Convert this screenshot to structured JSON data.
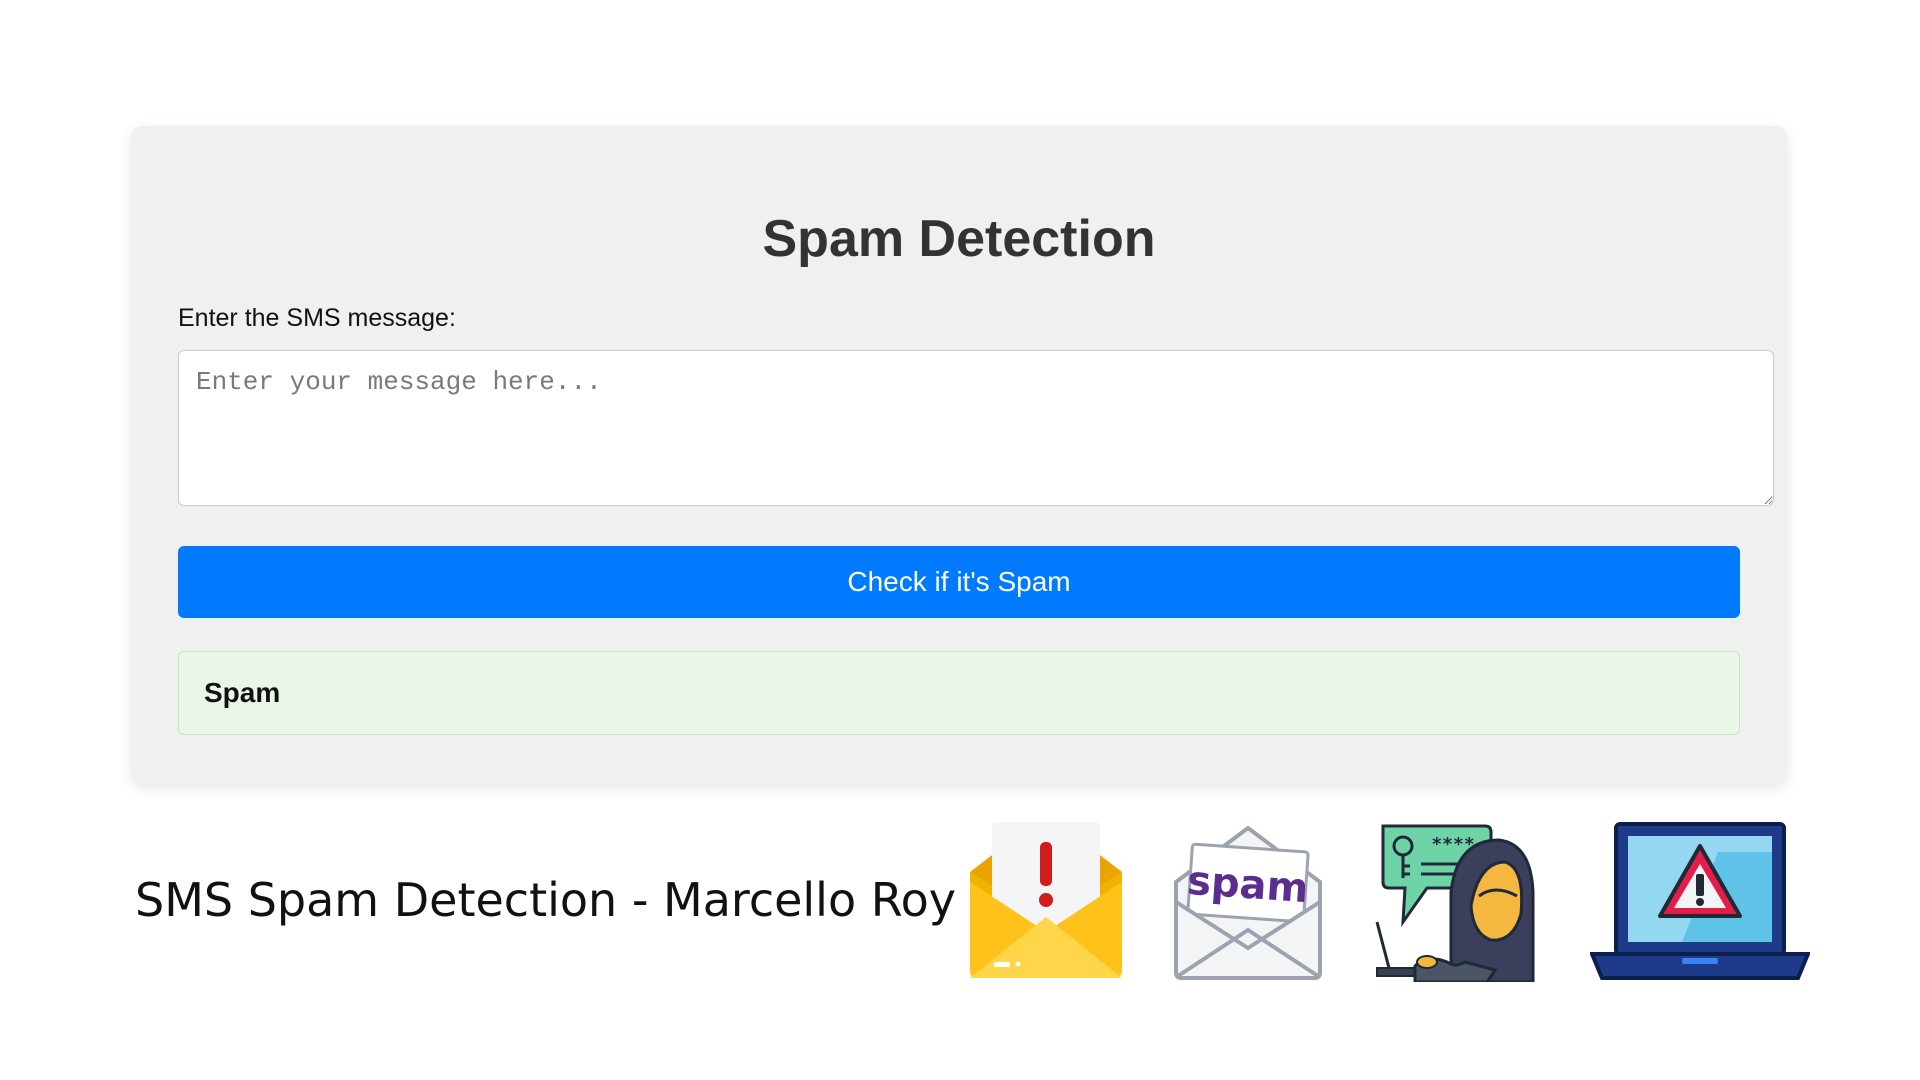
{
  "app": {
    "title": "Spam Detection"
  },
  "form": {
    "label": "Enter the SMS message:",
    "input_placeholder": "Enter your message here...",
    "input_value": "",
    "submit_label": "Check if it's Spam"
  },
  "result": {
    "text": "Spam",
    "background_color": "#eaf6e8"
  },
  "caption": {
    "text": "SMS Spam Detection - Marcello Roy"
  },
  "illustrations": [
    {
      "name": "envelope-alert-icon"
    },
    {
      "name": "spam-envelope-icon",
      "text": "spam"
    },
    {
      "name": "hacker-icon",
      "text": "****"
    },
    {
      "name": "laptop-warning-icon"
    }
  ],
  "colors": {
    "accent": "#007bff",
    "card_background": "#f0f0f0",
    "title": "#333333"
  }
}
